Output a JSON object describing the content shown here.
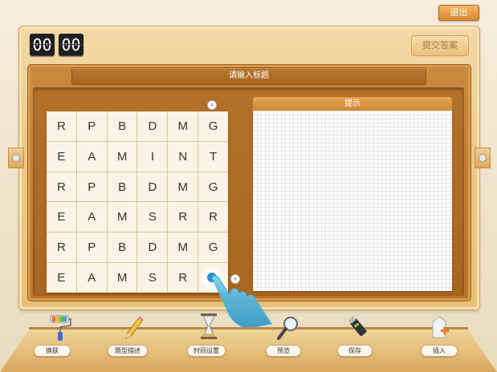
{
  "header": {
    "exit_label": "退出"
  },
  "timer": {
    "minutes": "00",
    "seconds": "00"
  },
  "toolbar": {
    "submit_label": "提交答案"
  },
  "board": {
    "title_placeholder": "请输入标题",
    "grid": [
      [
        "R",
        "P",
        "B",
        "D",
        "M",
        "G"
      ],
      [
        "E",
        "A",
        "M",
        "I",
        "N",
        "T"
      ],
      [
        "R",
        "P",
        "B",
        "D",
        "M",
        "G"
      ],
      [
        "E",
        "A",
        "M",
        "S",
        "R",
        "R"
      ],
      [
        "R",
        "P",
        "B",
        "D",
        "M",
        "G"
      ],
      [
        "E",
        "A",
        "M",
        "S",
        "R",
        ""
      ]
    ],
    "close_glyph": "×"
  },
  "hint": {
    "title": "提示"
  },
  "tools": [
    {
      "label": "换肤",
      "icon": "paint-roller-icon"
    },
    {
      "label": "题型描述",
      "icon": "pencil-icon"
    },
    {
      "label": "时间设置",
      "icon": "hourglass-icon"
    },
    {
      "label": "预览",
      "icon": "magnifier-icon"
    },
    {
      "label": "保存",
      "icon": "usb-drive-icon"
    },
    {
      "label": "插入",
      "icon": "insert-document-icon"
    }
  ],
  "colors": {
    "accent": "#d9862f",
    "wood": "#b87427",
    "pointer": "#2d8fc9"
  }
}
